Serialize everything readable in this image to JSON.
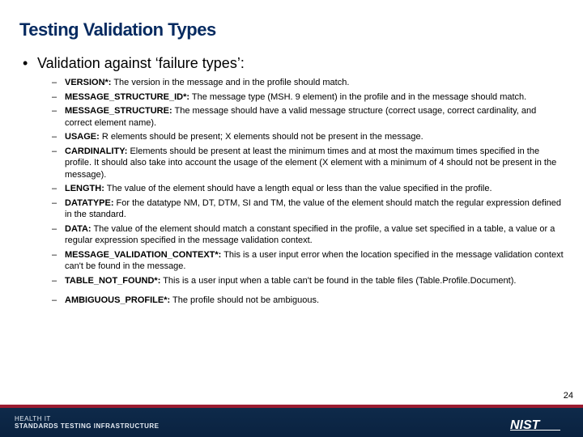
{
  "title": "Testing Validation Types",
  "lead": "Validation against ‘failure types’:",
  "items": [
    {
      "term": "VERSION*:",
      "desc": " The version in the message and in the profile should match."
    },
    {
      "term": "MESSAGE_STRUCTURE_ID*:",
      "desc": " The message type (MSH. 9 element) in the profile and in the message should match."
    },
    {
      "term": "MESSAGE_STRUCTURE:",
      "desc": " The message should have a valid message structure (correct usage, correct cardinality, and correct element name)."
    },
    {
      "term": "USAGE:",
      "desc": " R elements should be present; X elements should not be present in the message."
    },
    {
      "term": "CARDINALITY:",
      "desc": " Elements should be present at least the minimum times and at most the maximum times specified in the profile. It should also take into account the usage of the element (X element with a minimum of 4 should not be present in the message)."
    },
    {
      "term": "LENGTH:",
      "desc": " The value of the element should have a length equal or less than the value specified in the profile."
    },
    {
      "term": "DATATYPE:",
      "desc": " For the datatype NM, DT, DTM, SI and TM, the value of the element should match the regular expression defined in the standard."
    },
    {
      "term": "DATA:",
      "desc": " The value of the element should match a constant specified in the profile, a value set specified in a table, a value or a regular expression specified in the message validation context."
    },
    {
      "term": "MESSAGE_VALIDATION_CONTEXT*:",
      "desc": " This is a user input error when the location specified in the message validation context can't be found in the message."
    },
    {
      "term": "TABLE_NOT_FOUND*:",
      "desc": " This is a user input when a table can't be found in the table files (Table.Profile.Document)."
    },
    {
      "term": "AMBIGUOUS_PROFILE*:",
      "desc": " The profile should not be ambiguous.",
      "sep": true
    }
  ],
  "footer": {
    "line1": "HEALTH IT",
    "line2": "STANDARDS TESTING INFRASTRUCTURE",
    "logo_alt": "NIST"
  },
  "page": "24"
}
